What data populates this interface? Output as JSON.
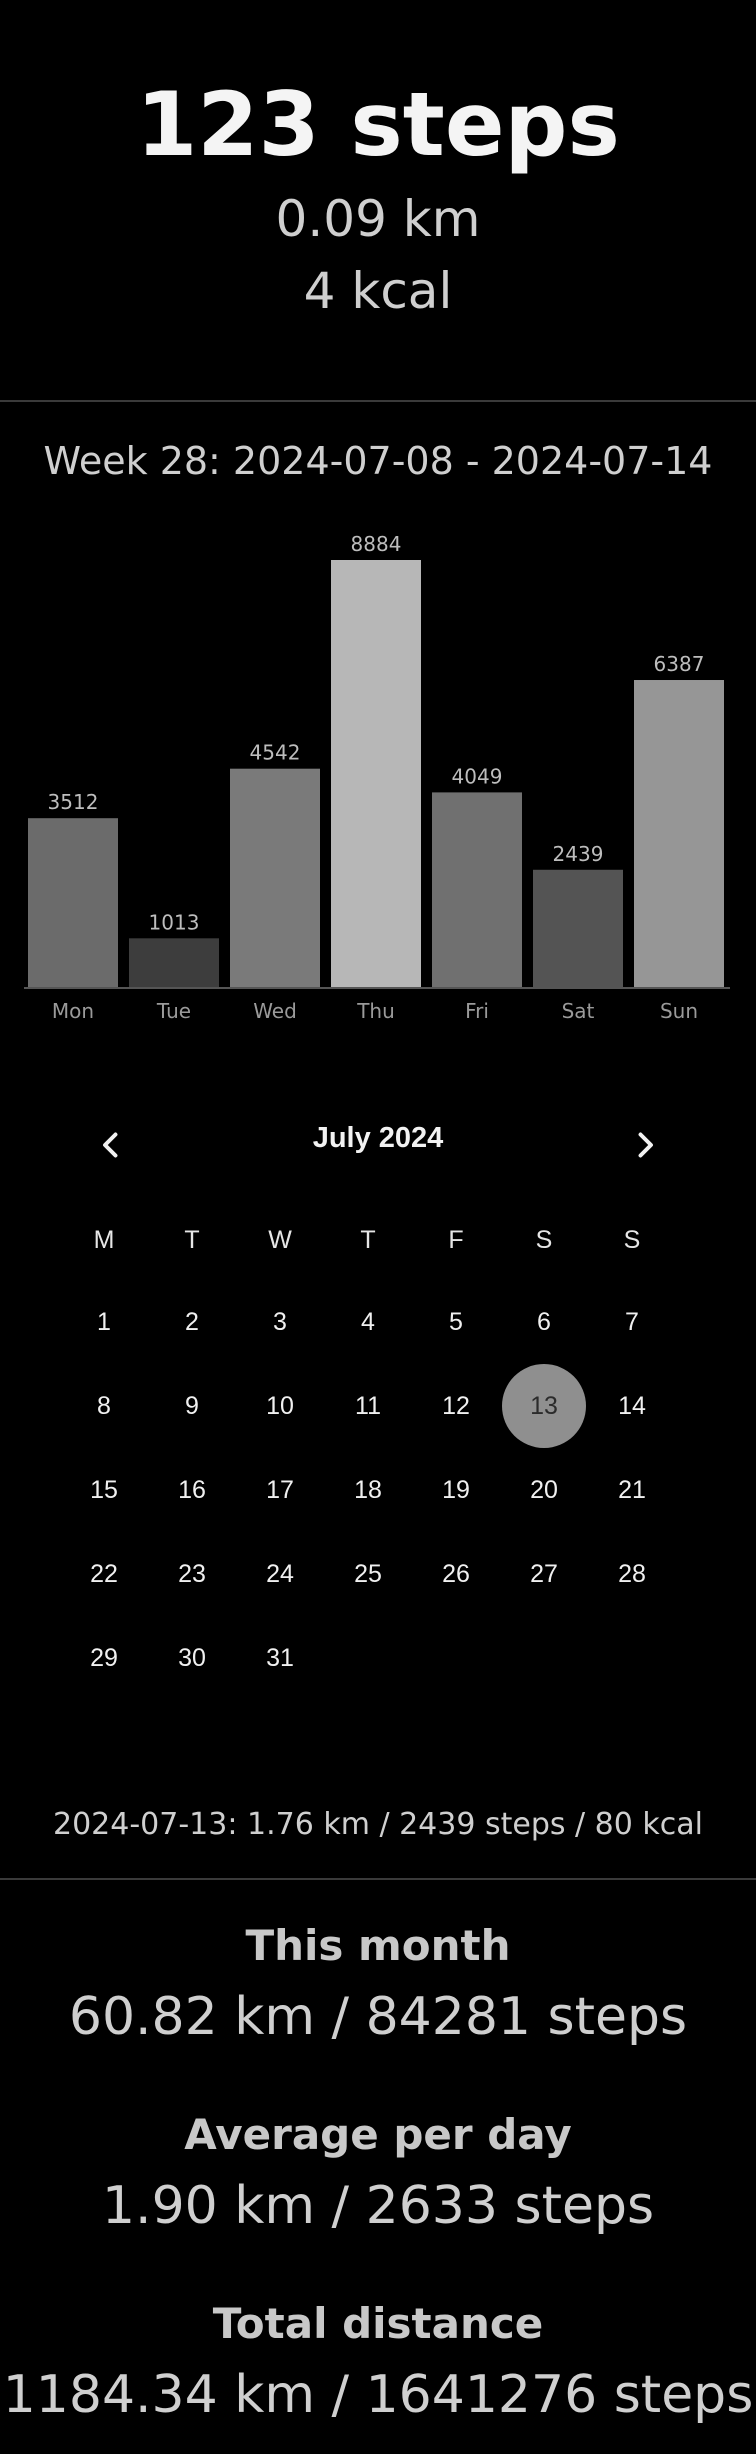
{
  "today": {
    "steps": "123 steps",
    "distance": "0.09 km",
    "energy": "4 kcal"
  },
  "week_title": "Week 28: 2024-07-08 - 2024-07-14",
  "chart_data": {
    "type": "bar",
    "categories": [
      "Mon",
      "Tue",
      "Wed",
      "Thu",
      "Fri",
      "Sat",
      "Sun"
    ],
    "values": [
      3512,
      1013,
      4542,
      8884,
      4049,
      2439,
      6387
    ],
    "bar_colors": [
      "#6b6b6b",
      "#3d3d3d",
      "#7a7a7a",
      "#b7b7b7",
      "#707070",
      "#545454",
      "#969696"
    ],
    "title": "",
    "xlabel": "",
    "ylabel": "",
    "ylim": [
      0,
      8884
    ],
    "grid": false,
    "legend": "none"
  },
  "calendar": {
    "month_title": "July 2024",
    "prev_icon": "chevron-left-icon",
    "next_icon": "chevron-right-icon",
    "weekdays": [
      "M",
      "T",
      "W",
      "T",
      "F",
      "S",
      "S"
    ],
    "days": [
      "1",
      "2",
      "3",
      "4",
      "5",
      "6",
      "7",
      "8",
      "9",
      "10",
      "11",
      "12",
      "13",
      "14",
      "15",
      "16",
      "17",
      "18",
      "19",
      "20",
      "21",
      "22",
      "23",
      "24",
      "25",
      "26",
      "27",
      "28",
      "29",
      "30",
      "31"
    ],
    "selected_day": "13",
    "selected_color": "#8f8f8f"
  },
  "day_summary": "2024-07-13: 1.76 km / 2439 steps / 80 kcal",
  "stats": {
    "month_label": "This month",
    "month_value": "60.82 km / 84281 steps",
    "average_label": "Average per day",
    "average_value": "1.90 km / 2633 steps",
    "total_label": "Total distance",
    "total_value": "1184.34 km / 1641276 steps"
  }
}
